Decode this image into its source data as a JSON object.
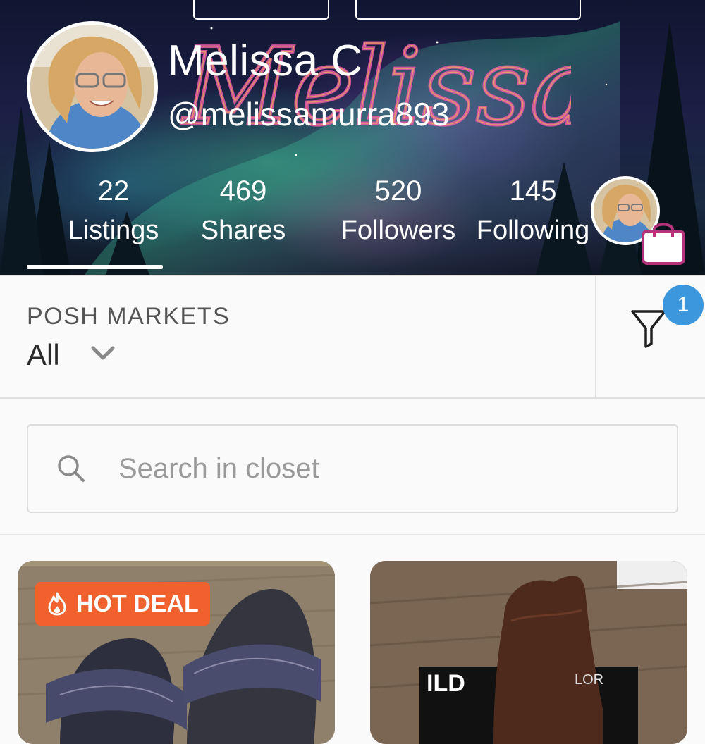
{
  "profile": {
    "banner_text": "Melissa",
    "display_name": "Melissa C",
    "handle": "@melissamurra893"
  },
  "stats": [
    {
      "value": "22",
      "label": "Listings"
    },
    {
      "value": "469",
      "label": "Shares"
    },
    {
      "value": "520",
      "label": "Followers"
    },
    {
      "value": "145",
      "label": "Following"
    }
  ],
  "active_stat": "Listings",
  "filter": {
    "title": "POSH MARKETS",
    "value": "All",
    "badge_count": "1"
  },
  "search": {
    "placeholder": "Search in closet"
  },
  "listings": [
    {
      "badge": "HOT DEAL",
      "item": "sandals"
    },
    {
      "badge": "",
      "item": "suede ankle boot"
    }
  ],
  "colors": {
    "hot_deal": "#f0612d",
    "badge_blue": "#3d97dd",
    "bag_pink": "#b5337a"
  },
  "icons": [
    "funnel-icon",
    "search-icon",
    "chevron-down-icon",
    "shopping-bag-icon",
    "flame-icon"
  ]
}
